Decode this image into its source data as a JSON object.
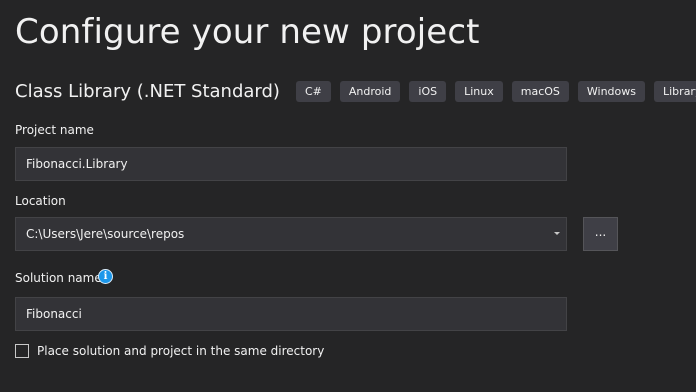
{
  "page": {
    "title": "Configure your new project"
  },
  "template": {
    "name": "Class Library (.NET Standard)",
    "tags": [
      "C#",
      "Android",
      "iOS",
      "Linux",
      "macOS",
      "Windows",
      "Library"
    ]
  },
  "project_name": {
    "label": "Project name",
    "value": "Fibonacci.Library"
  },
  "location": {
    "label": "Location",
    "value": "C:\\Users\\Jere\\source\\repos",
    "browse_label": "..."
  },
  "solution_name": {
    "label": "Solution name",
    "value": "Fibonacci",
    "info_icon": "i"
  },
  "same_directory": {
    "label": "Place solution and project in the same directory",
    "checked": false
  },
  "colors": {
    "background": "#252526",
    "field_background": "#333337",
    "field_border": "#434346",
    "tag_background": "#3f3f46",
    "info_icon": "#1c97ea"
  }
}
